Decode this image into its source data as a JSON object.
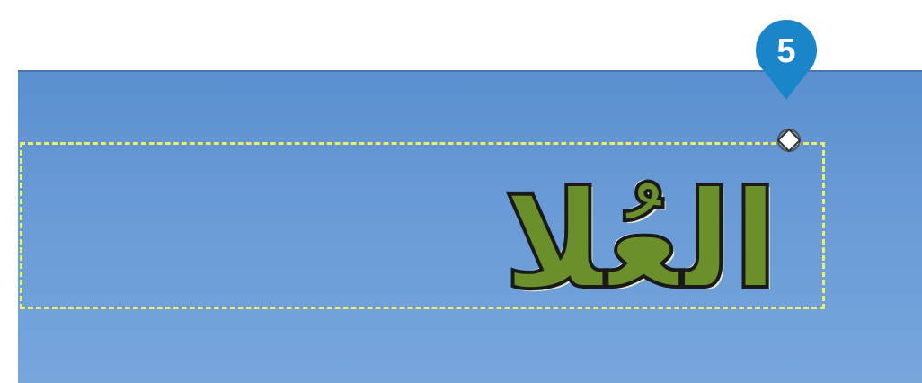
{
  "canvas": {
    "text_layer": "العُلا",
    "background_color": "#6a9bd6",
    "text_fill_color": "#6b8f2a"
  },
  "selection": {
    "style": "marching-ants",
    "colors": [
      "#1c1c1c",
      "#e7f06a"
    ]
  },
  "handle": {
    "icon": "transform-handle-icon"
  },
  "step_badge": {
    "number": "5",
    "color": "#1a86c9"
  }
}
